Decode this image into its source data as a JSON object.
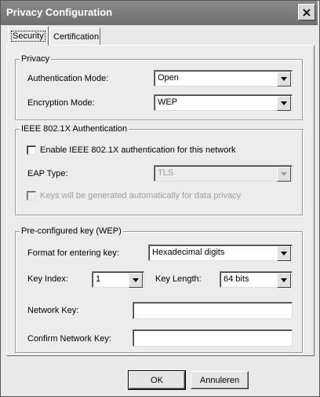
{
  "window": {
    "title": "Privacy Configuration"
  },
  "tabs": [
    {
      "label": "Security",
      "active": true
    },
    {
      "label": "Certification",
      "active": false
    }
  ],
  "privacy": {
    "legend": "Privacy",
    "auth_mode_label": "Authentication Mode:",
    "auth_mode_value": "Open",
    "enc_mode_label": "Encryption Mode:",
    "enc_mode_value": "WEP"
  },
  "ieee": {
    "legend": "IEEE 802.1X Authentication",
    "enable_label": "Enable IEEE 802.1X authentication for this network",
    "eap_type_label": "EAP Type:",
    "eap_type_value": "TLS",
    "keys_auto_label": "Keys will be generated automatically for data privacy"
  },
  "preconf": {
    "legend": "Pre-configured key (WEP)",
    "format_label": "Format for entering key:",
    "format_value": "Hexadecimal digits",
    "key_index_label": "Key Index:",
    "key_index_value": "1",
    "key_length_label": "Key Length:",
    "key_length_value": "64 bits",
    "network_key_label": "Network Key:",
    "network_key_value": "",
    "confirm_key_label": "Confirm Network Key:",
    "confirm_key_value": ""
  },
  "buttons": {
    "ok": "OK",
    "cancel": "Annuleren"
  },
  "icons": {
    "close": "close-icon",
    "dropdown": "chevron-down-icon"
  }
}
